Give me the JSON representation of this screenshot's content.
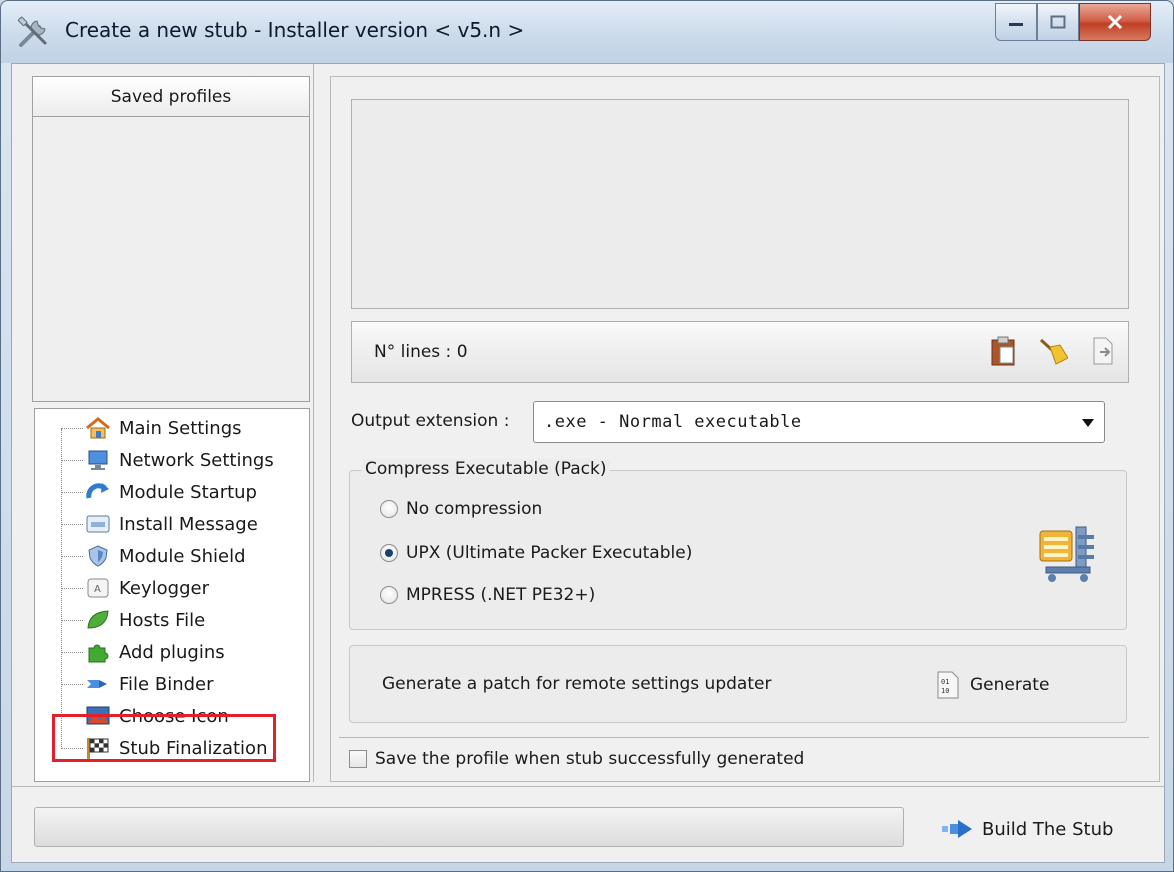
{
  "window": {
    "title": "Create a new stub - Installer version < v5.n >",
    "icon": "tools-icon"
  },
  "left": {
    "profiles_header": "Saved profiles",
    "tree": [
      {
        "label": "Main Settings",
        "icon": "home-icon"
      },
      {
        "label": "Network Settings",
        "icon": "monitor-icon"
      },
      {
        "label": "Module Startup",
        "icon": "startup-arrow-icon"
      },
      {
        "label": "Install Message",
        "icon": "message-box-icon"
      },
      {
        "label": "Module Shield",
        "icon": "shield-icon"
      },
      {
        "label": "Keylogger",
        "icon": "keyboard-key-icon"
      },
      {
        "label": "Hosts File",
        "icon": "leaf-icon"
      },
      {
        "label": "Add plugins",
        "icon": "puzzle-icon"
      },
      {
        "label": "File Binder",
        "icon": "binder-arrow-icon"
      },
      {
        "label": "Choose Icon",
        "icon": "picture-icon"
      },
      {
        "label": "Stub Finalization",
        "icon": "checkered-flag-icon",
        "selected": true
      }
    ]
  },
  "right": {
    "lines_label": "N° lines : 0",
    "output_extension_label": "Output extension :",
    "output_extension_value": ".exe - Normal executable",
    "compress_title": "Compress Executable (Pack)",
    "compress_options": [
      {
        "label": "No compression",
        "checked": false
      },
      {
        "label": "UPX (Ultimate Packer Executable)",
        "checked": true
      },
      {
        "label": "MPRESS (.NET PE32+)",
        "checked": false
      }
    ],
    "patch_text": "Generate a patch for remote settings updater",
    "generate_label": "Generate",
    "save_profile_label": "Save the profile when stub successfully generated",
    "save_profile_checked": false
  },
  "bottom": {
    "progress": 0,
    "build_label": "Build The Stub"
  },
  "colors": {
    "highlight": "#e0202a",
    "close_button": "#c8472f"
  }
}
